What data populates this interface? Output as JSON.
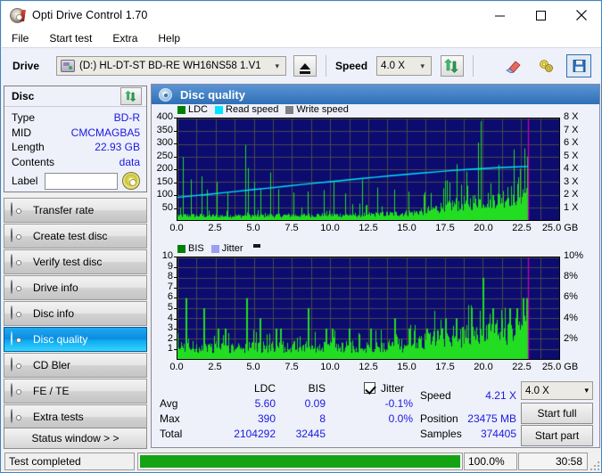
{
  "window": {
    "title": "Opti Drive Control 1.70",
    "app_icon": "disc-icon",
    "controls": {
      "minimize": "minimize-icon",
      "maximize": "maximize-icon",
      "close": "close-icon"
    }
  },
  "menu": {
    "items": [
      "File",
      "Start test",
      "Extra",
      "Help"
    ]
  },
  "toolbar": {
    "drive_label": "Drive",
    "drive_value": "(D:)   HL-DT-ST BD-RE  WH16NS58 1.V1",
    "eject_icon": "eject-icon",
    "speed_label": "Speed",
    "speed_value": "4.0 X",
    "refresh_icon": "refresh-arrows-icon",
    "erase_icon": "eraser-icon",
    "settings_icon": "gears-icon",
    "save_icon": "save-floppy-icon"
  },
  "disc": {
    "title": "Disc",
    "refresh_icon": "refresh-arrows-icon",
    "rows": [
      {
        "key": "Type",
        "value": "BD-R"
      },
      {
        "key": "MID",
        "value": "CMCMAGBA5"
      },
      {
        "key": "Length",
        "value": "22.93 GB"
      },
      {
        "key": "Contents",
        "value": "data"
      }
    ],
    "label_key": "Label",
    "label_value": "",
    "label_placeholder": "",
    "browse_icon": "cd-disc-icon"
  },
  "nav": {
    "items": [
      {
        "label": "Transfer rate",
        "icon": "disc-transfer-icon",
        "active": false
      },
      {
        "label": "Create test disc",
        "icon": "disc-create-icon",
        "active": false
      },
      {
        "label": "Verify test disc",
        "icon": "disc-verify-icon",
        "active": false
      },
      {
        "label": "Drive info",
        "icon": "drive-info-icon",
        "active": false
      },
      {
        "label": "Disc info",
        "icon": "disc-info-icon",
        "active": false
      },
      {
        "label": "Disc quality",
        "icon": "disc-quality-icon",
        "active": true
      },
      {
        "label": "CD Bler",
        "icon": "disc-bler-icon",
        "active": false
      },
      {
        "label": "FE / TE",
        "icon": "disc-fete-icon",
        "active": false
      },
      {
        "label": "Extra tests",
        "icon": "disc-extra-icon",
        "active": false
      }
    ],
    "status_window": "Status window > >"
  },
  "panel": {
    "title": "Disc quality",
    "icon": "disc-quality-icon"
  },
  "results": {
    "col_ldc": "LDC",
    "col_bis": "BIS",
    "jitter_label": "Jitter",
    "jitter_checked": true,
    "rows": [
      {
        "name": "Avg",
        "ldc": "5.60",
        "bis": "0.09",
        "jitter": "-0.1%"
      },
      {
        "name": "Max",
        "ldc": "390",
        "bis": "8",
        "jitter": "0.0%"
      },
      {
        "name": "Total",
        "ldc": "2104292",
        "bis": "32445",
        "jitter": ""
      }
    ],
    "speed_label": "Speed",
    "speed_value": "4.21 X",
    "position_label": "Position",
    "position_value": "23475 MB",
    "samples_label": "Samples",
    "samples_value": "374405",
    "speed_select": "4.0 X",
    "start_full": "Start full",
    "start_part": "Start part"
  },
  "statusbar": {
    "text": "Test completed",
    "progress_percent": "100.0%",
    "progress_value": 100,
    "elapsed": "30:58"
  },
  "chart_data": [
    {
      "id": "ldc-chart",
      "type": "line",
      "title": "LDC / Read speed",
      "xlabel": "GB",
      "ylabel": "LDC",
      "xlim": [
        0,
        25
      ],
      "ylim": [
        0,
        400
      ],
      "y2lim": [
        0,
        8
      ],
      "y2label": "X",
      "grid": true,
      "legend_position": "top-left",
      "xticks": [
        "0.0",
        "2.5",
        "5.0",
        "7.5",
        "10.0",
        "12.5",
        "15.0",
        "17.5",
        "20.0",
        "22.5",
        "25.0 GB"
      ],
      "yticks": [
        50,
        100,
        150,
        200,
        250,
        300,
        350,
        400
      ],
      "y2ticks": [
        "1 X",
        "2 X",
        "3 X",
        "4 X",
        "5 X",
        "6 X",
        "7 X",
        "8 X"
      ],
      "legend": [
        {
          "name": "LDC",
          "color": "#00a000",
          "type": "bar"
        },
        {
          "name": "Read speed",
          "color": "#00e5ff",
          "type": "line"
        },
        {
          "name": "Write speed",
          "color": "#808080",
          "type": "line"
        }
      ],
      "data_end_gb": 23.0,
      "series": [
        {
          "name": "Read speed",
          "color": "#00e5ff",
          "axis": "y2",
          "x": [
            0.0,
            1.0,
            2.0,
            3.0,
            4.0,
            5.0,
            6.0,
            7.0,
            8.0,
            9.0,
            10.0,
            11.0,
            12.0,
            13.0,
            14.0,
            15.0,
            16.0,
            17.0,
            18.0,
            19.0,
            20.0,
            21.0,
            22.0,
            23.0
          ],
          "y": [
            1.78,
            1.9,
            2.02,
            2.15,
            2.27,
            2.4,
            2.52,
            2.65,
            2.78,
            2.9,
            3.02,
            3.14,
            3.26,
            3.38,
            3.49,
            3.6,
            3.7,
            3.8,
            3.9,
            3.98,
            4.05,
            4.12,
            4.18,
            4.22
          ]
        },
        {
          "name": "LDC",
          "color": "#22cc22",
          "axis": "y1",
          "note": "baseline envelope rises from ~20 near 0 GB to ~110 near 23 GB with sharp spikes",
          "baseline_x": [
            0.0,
            2.0,
            4.0,
            6.0,
            8.0,
            10.0,
            12.0,
            14.0,
            15.5,
            16.5,
            17.5,
            18.5,
            19.5,
            20.5,
            21.5,
            22.5,
            23.0
          ],
          "baseline_y": [
            18,
            16,
            16,
            17,
            18,
            19,
            20,
            23,
            28,
            38,
            52,
            62,
            70,
            78,
            88,
            100,
            108
          ],
          "spikes": [
            {
              "x": 0.35,
              "y": 248
            },
            {
              "x": 0.9,
              "y": 160
            },
            {
              "x": 1.55,
              "y": 172
            },
            {
              "x": 1.9,
              "y": 120
            },
            {
              "x": 2.55,
              "y": 150
            },
            {
              "x": 3.3,
              "y": 108
            },
            {
              "x": 4.45,
              "y": 295
            },
            {
              "x": 4.6,
              "y": 205
            },
            {
              "x": 5.05,
              "y": 150
            },
            {
              "x": 5.45,
              "y": 122
            },
            {
              "x": 6.05,
              "y": 188
            },
            {
              "x": 6.6,
              "y": 122
            },
            {
              "x": 7.6,
              "y": 108
            },
            {
              "x": 8.55,
              "y": 112
            },
            {
              "x": 9.6,
              "y": 118
            },
            {
              "x": 10.25,
              "y": 148
            },
            {
              "x": 11.0,
              "y": 105
            },
            {
              "x": 12.1,
              "y": 160
            },
            {
              "x": 13.1,
              "y": 128
            },
            {
              "x": 14.2,
              "y": 120
            },
            {
              "x": 15.1,
              "y": 112
            },
            {
              "x": 16.2,
              "y": 110
            },
            {
              "x": 17.4,
              "y": 125
            },
            {
              "x": 18.3,
              "y": 220
            },
            {
              "x": 19.0,
              "y": 135
            },
            {
              "x": 19.7,
              "y": 305
            },
            {
              "x": 19.85,
              "y": 390
            },
            {
              "x": 20.5,
              "y": 145
            },
            {
              "x": 21.0,
              "y": 218
            },
            {
              "x": 21.6,
              "y": 130
            },
            {
              "x": 22.3,
              "y": 168
            },
            {
              "x": 22.75,
              "y": 282
            },
            {
              "x": 22.9,
              "y": 250
            }
          ]
        }
      ],
      "markers": [
        {
          "name": "end-marker",
          "x": 22.95,
          "color": "#d400a8"
        }
      ]
    },
    {
      "id": "bis-chart",
      "type": "bar",
      "title": "BIS / Jitter",
      "xlabel": "GB",
      "ylabel": "BIS",
      "xlim": [
        0,
        25
      ],
      "ylim": [
        0,
        10
      ],
      "y2lim": [
        0,
        10
      ],
      "y2label": "%",
      "grid": true,
      "legend_position": "top-left",
      "xticks": [
        "0.0",
        "2.5",
        "5.0",
        "7.5",
        "10.0",
        "12.5",
        "15.0",
        "17.5",
        "20.0",
        "22.5",
        "25.0 GB"
      ],
      "yticks": [
        1,
        2,
        3,
        4,
        5,
        6,
        7,
        8,
        9,
        10
      ],
      "y2ticks": [
        "2%",
        "4%",
        "6%",
        "8%",
        "10%"
      ],
      "legend": [
        {
          "name": "BIS",
          "color": "#00a000",
          "type": "bar"
        },
        {
          "name": "Jitter",
          "color": "#9aa0f0",
          "type": "line"
        }
      ],
      "data_end_gb": 23.0,
      "series": [
        {
          "name": "BIS",
          "color": "#22cc22",
          "axis": "y1",
          "note": "dense bars mostly 1-2 rising to 2-3 after 15 GB, scattered spikes to 8",
          "baseline_x": [
            0.0,
            3.0,
            6.0,
            9.0,
            12.0,
            15.0,
            16.0,
            17.5,
            19.0,
            20.5,
            22.0,
            23.0
          ],
          "baseline_y": [
            1.0,
            1.0,
            1.1,
            1.1,
            1.1,
            1.2,
            1.6,
            1.9,
            2.0,
            2.2,
            2.4,
            2.6
          ],
          "spikes": [
            {
              "x": 0.55,
              "y": 6
            },
            {
              "x": 1.7,
              "y": 5
            },
            {
              "x": 2.6,
              "y": 3
            },
            {
              "x": 3.1,
              "y": 3
            },
            {
              "x": 4.5,
              "y": 6
            },
            {
              "x": 5.4,
              "y": 4
            },
            {
              "x": 6.4,
              "y": 3
            },
            {
              "x": 6.7,
              "y": 3
            },
            {
              "x": 8.5,
              "y": 5
            },
            {
              "x": 9.7,
              "y": 3
            },
            {
              "x": 10.1,
              "y": 3
            },
            {
              "x": 11.2,
              "y": 3
            },
            {
              "x": 12.6,
              "y": 3
            },
            {
              "x": 14.2,
              "y": 4
            },
            {
              "x": 15.1,
              "y": 3
            },
            {
              "x": 16.3,
              "y": 3
            },
            {
              "x": 17.5,
              "y": 4
            },
            {
              "x": 18.2,
              "y": 4
            },
            {
              "x": 19.2,
              "y": 4
            },
            {
              "x": 19.95,
              "y": 8
            },
            {
              "x": 20.6,
              "y": 5
            },
            {
              "x": 21.2,
              "y": 4
            },
            {
              "x": 21.7,
              "y": 5
            },
            {
              "x": 22.2,
              "y": 5
            },
            {
              "x": 22.6,
              "y": 6
            },
            {
              "x": 22.85,
              "y": 6
            }
          ]
        }
      ],
      "markers": [
        {
          "name": "end-marker",
          "x": 22.95,
          "color": "#d400a8"
        }
      ]
    }
  ]
}
